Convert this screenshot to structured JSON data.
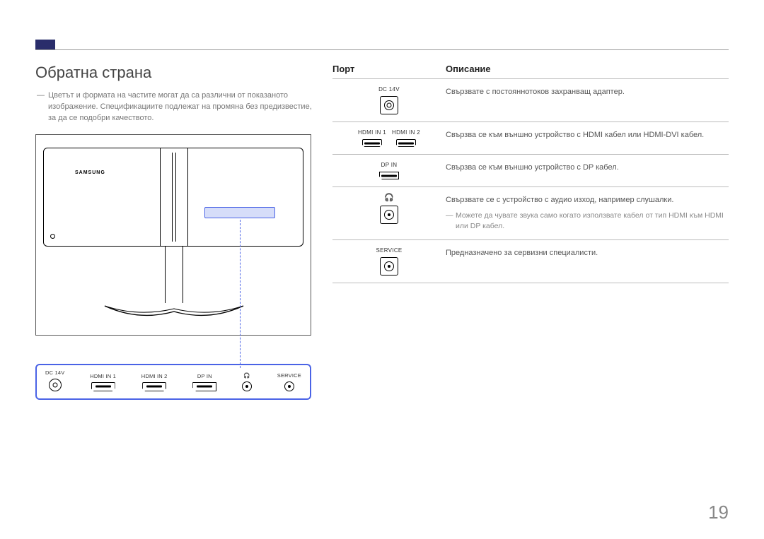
{
  "page": {
    "number": "19"
  },
  "header": {
    "title": "Обратна страна"
  },
  "note": "Цветът и формата на частите могат да са различни от показаното изображение. Спецификациите подлежат на промяна без предизвестие, за да се подобри качеството.",
  "monitor": {
    "brand": "SAMSUNG"
  },
  "enlarged_ports": [
    {
      "label": "DC 14V",
      "icon": "dc"
    },
    {
      "label": "HDMI IN 1",
      "icon": "hdmi"
    },
    {
      "label": "HDMI IN 2",
      "icon": "hdmi"
    },
    {
      "label": "DP IN",
      "icon": "dp"
    },
    {
      "label": "",
      "icon": "headphone"
    },
    {
      "label": "SERVICE",
      "icon": "service"
    }
  ],
  "table": {
    "head": {
      "port": "Порт",
      "desc": "Описание"
    },
    "rows": [
      {
        "labels": [
          "DC 14V"
        ],
        "icon": "dc-box",
        "desc": "Свързвате с постояннотоков захранващ адаптер."
      },
      {
        "labels": [
          "HDMI IN 1",
          "HDMI IN 2"
        ],
        "icon": "hdmi-dual",
        "desc": "Свързва се към външно устройство с HDMI кабел или HDMI-DVI кабел."
      },
      {
        "labels": [
          "DP IN"
        ],
        "icon": "dp",
        "desc": "Свързва се към външно устройство с DP кабел."
      },
      {
        "labels": [
          ""
        ],
        "icon": "headphone-box",
        "desc": "Свързвате се с устройство с аудио изход, например слушалки.",
        "subnote": "Можете да чувате звука само когато използвате кабел от тип HDMI към HDMI или DP кабел."
      },
      {
        "labels": [
          "SERVICE"
        ],
        "icon": "service-box",
        "desc": "Предназначено за сервизни специалисти."
      }
    ]
  }
}
